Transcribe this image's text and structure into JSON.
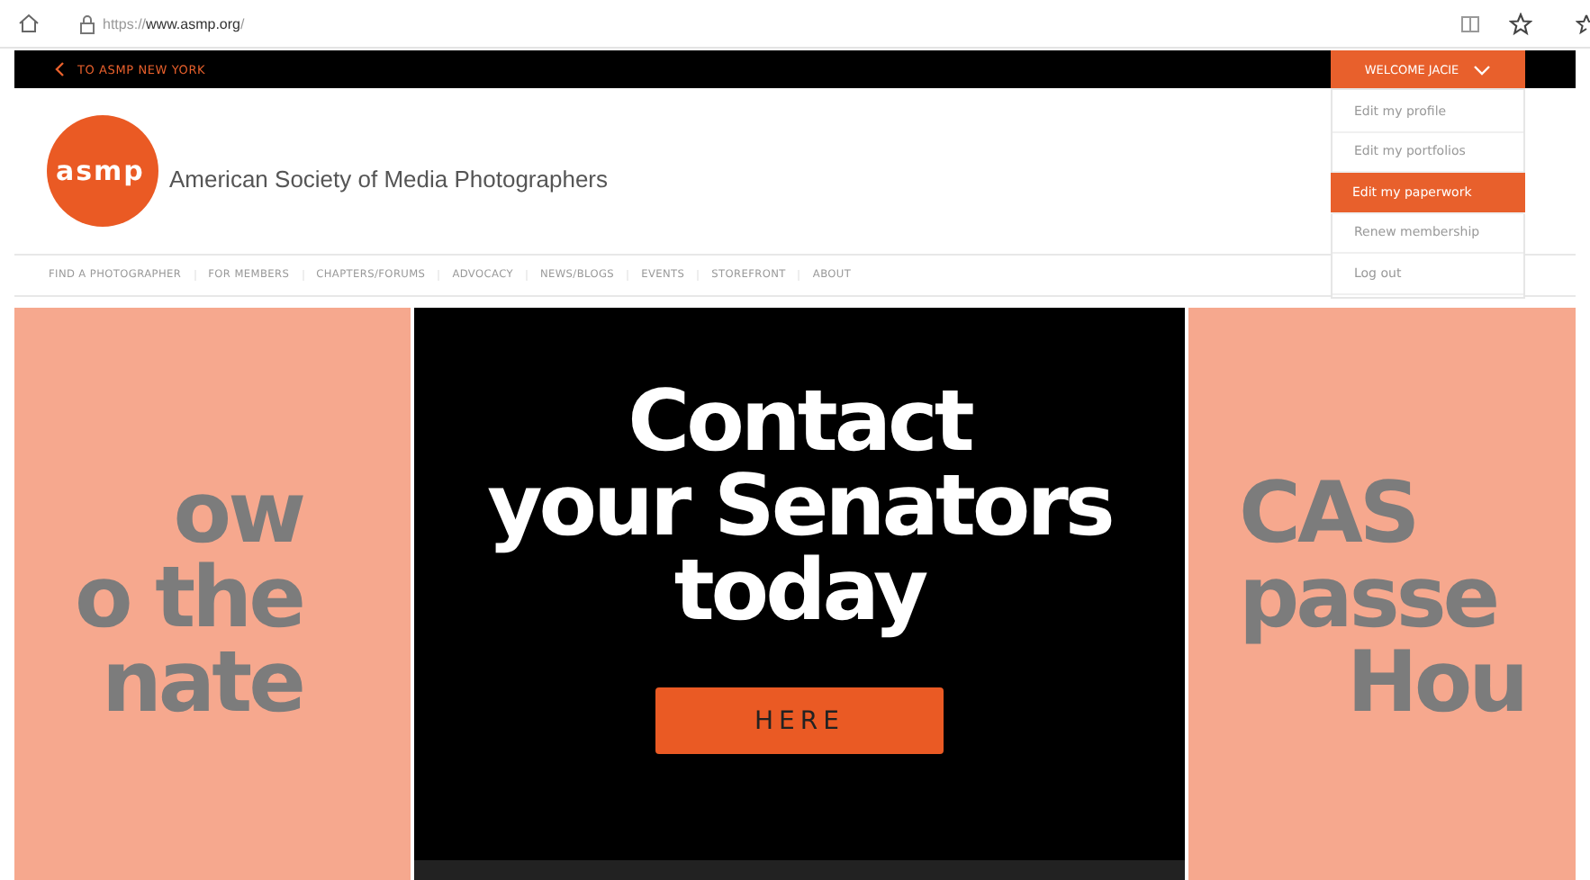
{
  "browser": {
    "url_prefix": "https://",
    "url_domain": "www.asmp.org",
    "url_suffix": "/"
  },
  "topbar": {
    "back_link": "TO ASMP NEW YORK",
    "welcome": "WELCOME JACIE",
    "menu_expanded": true
  },
  "user_menu": [
    {
      "label": "Edit my profile",
      "selected": false
    },
    {
      "label": "Edit my portfolios",
      "selected": false
    },
    {
      "label": "Edit my paperwork",
      "selected": true
    },
    {
      "label": "Renew membership",
      "selected": false
    },
    {
      "label": "Log out",
      "selected": false
    }
  ],
  "header": {
    "logo": "asmp",
    "title": "American Society of Media Photographers"
  },
  "nav": [
    "FIND A PHOTOGRAPHER",
    "FOR MEMBERS",
    "CHAPTERS/FORUMS",
    "ADVOCACY",
    "NEWS/BLOGS",
    "EVENTS",
    "STOREFRONT",
    "ABOUT"
  ],
  "slides": [
    {
      "kind": "left",
      "lines": [
        "ow",
        "o the",
        "nate"
      ]
    },
    {
      "kind": "center",
      "lines": [
        "Contact",
        "your Senators",
        "today"
      ],
      "button": "HERE"
    },
    {
      "kind": "right",
      "lines": [
        "CAS",
        "passe",
        "Hou"
      ]
    }
  ]
}
